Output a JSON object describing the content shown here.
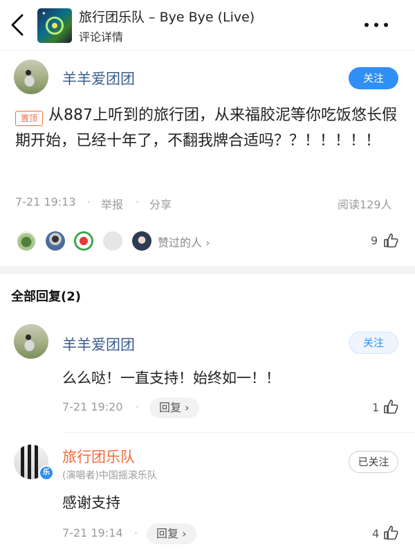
{
  "header": {
    "song_title": "旅行团乐队 – Bye Bye (Live)",
    "subtitle": "评论详情",
    "back_icon": "chevron-left-icon",
    "more_icon": "more-dots-icon"
  },
  "main_comment": {
    "username": "羊羊爱团团",
    "follow_label": "关注",
    "pin_label": "置顶",
    "text": "从887上听到的旅行团，从来福胶泥等你吃饭悠长假期开始，已经十年了，不翻我牌合适吗？？！！！！！",
    "date": "7-21 19:13",
    "report": "举报",
    "share": "分享",
    "reads": "阅读129人",
    "likers_label": "赞过的人",
    "like_count": "9"
  },
  "replies_header": "全部回复(2)",
  "replies": [
    {
      "username": "羊羊爱团团",
      "follow_label": "关注",
      "text": "么么哒！一直支持！始终如一！！",
      "date": "7-21 19:20",
      "reply_label": "回复",
      "like_count": "1"
    },
    {
      "username": "旅行团乐队",
      "subtitle": "(演唱者)中国摇滚乐队",
      "follow_label": "已关注",
      "text": "感谢支持",
      "date": "7-21 19:14",
      "reply_label": "回复",
      "like_count": "4"
    }
  ],
  "colors": {
    "accent": "#2f8ff5",
    "username": "#3b5d8f",
    "artist": "#f26b3a",
    "meta": "#9a9a9a"
  }
}
